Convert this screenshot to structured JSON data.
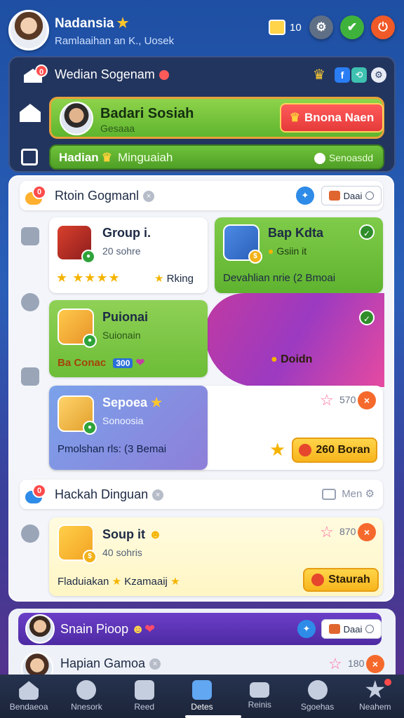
{
  "header": {
    "name": "Nadansia",
    "subtitle": "Ramlaaihan an K., Uosek",
    "mail_count": "10"
  },
  "top_panel": {
    "title": "Wedian Sogenam",
    "invite": {
      "name": "Badari Sosiah",
      "sub": "Gesaaa",
      "button": "Bnona Naen"
    },
    "bar": {
      "left": "Hadian",
      "left_sub": "Minguaiah",
      "right": "Senoasdd"
    }
  },
  "section1": {
    "title": "Rtoin Gogmanl",
    "chip": "Daai",
    "cards": [
      {
        "title": "Group i.",
        "sub": "20 sohre",
        "footer": "Rking"
      },
      {
        "title": "Bap Kdta",
        "sub": "Gsiin it",
        "footer": "Devahlian nrie (2 Bmoai"
      },
      {
        "title": "Puionai",
        "sub": "Suionain",
        "footer_left": "Ba Conac",
        "footer_tag": "300",
        "footer_right": "Doidn"
      },
      {
        "title": "Sepoea",
        "sub": "Sonoosia",
        "footer": "Pmolshan rls: (3 Bemai",
        "count": "570",
        "button": "260 Boran"
      }
    ]
  },
  "section2": {
    "title": "Hackah Dinguan",
    "right": "Men",
    "card": {
      "title": "Soup it",
      "sub": "40 sohris",
      "footer_left": "Fladuiakan",
      "footer_right": "Kzamaaij",
      "count": "870",
      "button": "Staurah"
    }
  },
  "bottom_list": [
    {
      "name": "Snain Pioop",
      "chip": "Daai"
    },
    {
      "name": "Hapian Gamoa",
      "count": "180"
    }
  ],
  "nav": [
    {
      "label": "Bendaeoa",
      "icon": "home-icon"
    },
    {
      "label": "Nnesork",
      "icon": "profile-icon"
    },
    {
      "label": "Reed",
      "icon": "feed-icon"
    },
    {
      "label": "Detes",
      "icon": "games-icon"
    },
    {
      "label": "Reinis",
      "icon": "mail-icon"
    },
    {
      "label": "Sgoehas",
      "icon": "smile-icon"
    },
    {
      "label": "Neahem",
      "icon": "achievement-icon"
    }
  ],
  "colors": {
    "accent_green": "#5fb52e",
    "accent_gold": "#f7b51c",
    "accent_red": "#e53a3a",
    "nav_bg": "#1b2439"
  }
}
